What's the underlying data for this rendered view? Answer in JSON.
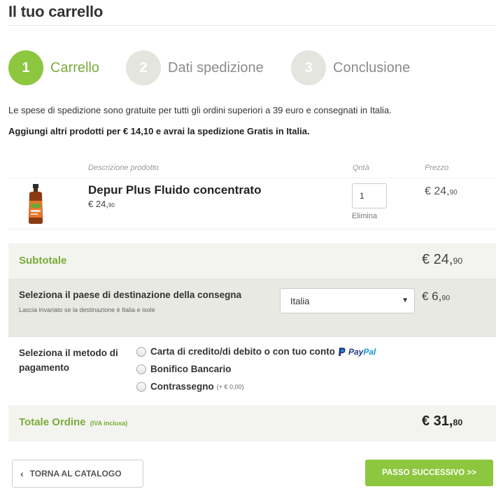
{
  "page": {
    "title": "Il tuo carrello"
  },
  "steps": [
    {
      "number": "1",
      "label": "Carrello"
    },
    {
      "number": "2",
      "label": "Dati spedizione"
    },
    {
      "number": "3",
      "label": "Conclusione"
    }
  ],
  "info": {
    "shipping_note": "Le spese di spedizione sono gratuite per tutti gli ordini superiori a 39 euro e consegnati in Italia.",
    "free_shipping_hint": "Aggiungi altri prodotti per € 14,10 e avrai la spedizione Gratis in Italia."
  },
  "table": {
    "headers": {
      "description": "Descrizione prodotto",
      "qty": "Qntà",
      "price": "Prezzo"
    }
  },
  "product": {
    "name": "Depur Plus Fluido concentrato",
    "unit_price_whole": "€ 24,",
    "unit_price_cents": "90",
    "quantity": "1",
    "remove_label": "Elimina",
    "row_price_whole": "€ 24,",
    "row_price_cents": "90",
    "image_icon": "bottle-image"
  },
  "subtotal": {
    "label": "Subtotale",
    "whole": "€ 24,",
    "cents": "90"
  },
  "destination": {
    "label": "Seleziona il paese di destinazione della consegna",
    "note": "Lascia invariato se la destinazione è Italia e isole",
    "selected": "Italia",
    "shipping_whole": "€ 6,",
    "shipping_cents": "90"
  },
  "payment": {
    "label": "Seleziona il metodo di pagamento",
    "options": [
      {
        "label": "Carta di credito/di debito o con tuo conto",
        "extra": ""
      },
      {
        "label": "Bonifico Bancario",
        "extra": ""
      },
      {
        "label": "Contrassegno",
        "extra": "(+ € 0,00)"
      }
    ],
    "paypal_part1": "Pay",
    "paypal_part2": "Pal"
  },
  "total": {
    "label": "Totale Ordine",
    "note": "(IVA inclusa)",
    "whole": "€ 31,",
    "cents": "80"
  },
  "buttons": {
    "back": "TORNA AL CATALOGO",
    "next": "PASSO SUCCESSIVO >>"
  },
  "colors": {
    "accent": "#8dc63f",
    "accent_text": "#7aab3a",
    "step_inactive": "#e3e5de"
  }
}
